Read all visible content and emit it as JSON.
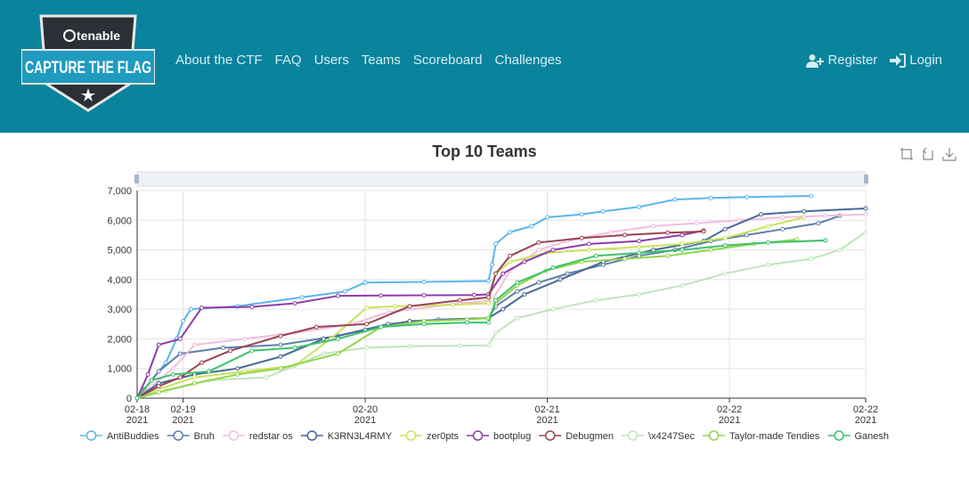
{
  "nav": {
    "logo_brand": "tenable",
    "logo_title": "CAPTURE THE FLAG",
    "links": [
      "About the CTF",
      "FAQ",
      "Users",
      "Teams",
      "Scoreboard",
      "Challenges"
    ],
    "register_label": "Register",
    "login_label": "Login",
    "icons": {
      "register": "user-plus-icon",
      "login": "sign-in-icon"
    }
  },
  "toolbox": [
    "zoom-icon",
    "zoom-reset-icon",
    "download-icon"
  ],
  "chart_data": {
    "type": "line",
    "title": "Top 10 Teams",
    "x_ticks": [
      [
        "02-18",
        "2021"
      ],
      [
        "02-19",
        "2021"
      ],
      [
        "02-20",
        "2021"
      ],
      [
        "02-21",
        "2021"
      ],
      [
        "02-22",
        "2021"
      ],
      [
        "02-22",
        "2021"
      ]
    ],
    "x_tick_days": [
      0,
      0.64,
      3.18,
      5.72,
      8.26,
      10.16
    ],
    "xlim_days": [
      0,
      10.16
    ],
    "ylim": [
      0,
      7000
    ],
    "y_ticks": [
      0,
      1000,
      2000,
      3000,
      4000,
      5000,
      6000,
      7000
    ],
    "y_tick_labels": [
      "0",
      "1,000",
      "2,000",
      "3,000",
      "4,000",
      "5,000",
      "6,000",
      "7,000"
    ],
    "x_unit": "days since 02-18 2021",
    "grid": true,
    "legend_position": "bottom",
    "series": [
      {
        "name": "AntiBuddies",
        "color": "#5ab6ea",
        "x": [
          0,
          0.2,
          0.4,
          0.55,
          0.64,
          0.75,
          1.4,
          2.3,
          2.9,
          3.18,
          4.0,
          4.9,
          4.95,
          5.0,
          5.2,
          5.5,
          5.72,
          6.2,
          6.5,
          7.0,
          7.5,
          8.0,
          8.5,
          9.4
        ],
        "y": [
          0,
          600,
          1200,
          2000,
          2600,
          3000,
          3100,
          3400,
          3600,
          3900,
          3920,
          3950,
          4500,
          5200,
          5600,
          5800,
          6100,
          6200,
          6300,
          6450,
          6700,
          6750,
          6780,
          6820
        ]
      },
      {
        "name": "Bruh",
        "color": "#5e7ea8",
        "x": [
          0,
          0.1,
          0.3,
          0.6,
          1.2,
          2.0,
          2.8,
          3.5,
          4.2,
          4.9,
          5.0,
          5.3,
          5.6,
          6.0,
          6.5,
          7.0,
          7.5,
          8.0,
          8.5,
          9.0,
          9.5,
          9.8
        ],
        "y": [
          0,
          300,
          900,
          1500,
          1700,
          1800,
          2100,
          2500,
          2650,
          2700,
          3100,
          3600,
          3900,
          4200,
          4500,
          4800,
          5000,
          5300,
          5500,
          5700,
          5900,
          6150
        ]
      },
      {
        "name": "redstar os",
        "color": "#f1bede",
        "x": [
          0,
          0.2,
          0.5,
          0.8,
          1.5,
          2.2,
          3.0,
          3.5,
          4.5,
          4.95,
          5.2,
          5.6,
          6.0,
          6.6,
          7.2,
          7.8,
          8.4,
          9.0,
          9.6,
          10.16
        ],
        "y": [
          0,
          400,
          1000,
          1800,
          2000,
          2200,
          2500,
          2900,
          3200,
          3300,
          4300,
          5000,
          5300,
          5600,
          5800,
          5900,
          6000,
          6100,
          6150,
          6200
        ]
      },
      {
        "name": "K3RN3L4RMY",
        "color": "#466996",
        "x": [
          0,
          0.3,
          0.8,
          1.4,
          2.0,
          2.6,
          3.18,
          3.8,
          4.9,
          5.1,
          5.4,
          5.9,
          6.5,
          7.2,
          7.9,
          8.2,
          8.7,
          9.3,
          10.16
        ],
        "y": [
          0,
          500,
          800,
          1000,
          1400,
          2000,
          2300,
          2600,
          2700,
          3000,
          3500,
          4000,
          4600,
          5000,
          5300,
          5700,
          6200,
          6300,
          6400
        ]
      },
      {
        "name": "zer0pts",
        "color": "#c8e35b",
        "x": [
          0,
          0.3,
          0.8,
          1.5,
          2.2,
          2.7,
          3.2,
          3.6,
          4.4,
          4.9,
          5.0,
          5.2,
          5.7,
          6.3,
          7.0,
          7.6,
          8.2,
          8.8,
          9.3
        ],
        "y": [
          0,
          300,
          700,
          900,
          1100,
          2000,
          3050,
          3100,
          3150,
          3200,
          4200,
          4600,
          4900,
          5000,
          5100,
          5200,
          5400,
          5800,
          6100
        ]
      },
      {
        "name": "bootplug",
        "color": "#8e3da8",
        "x": [
          0,
          0.15,
          0.3,
          0.6,
          0.9,
          1.6,
          2.2,
          2.8,
          3.4,
          4.0,
          4.7,
          4.9,
          5.1,
          5.4,
          5.8,
          6.3,
          7.0,
          7.6,
          7.9
        ],
        "y": [
          0,
          800,
          1800,
          2000,
          3050,
          3080,
          3200,
          3450,
          3460,
          3470,
          3480,
          3500,
          4200,
          4600,
          5000,
          5200,
          5300,
          5500,
          5650
        ]
      },
      {
        "name": "Debugmen",
        "color": "#9a4352",
        "x": [
          0,
          0.3,
          0.6,
          0.9,
          1.3,
          2.0,
          2.5,
          3.2,
          3.8,
          4.5,
          4.9,
          5.0,
          5.2,
          5.6,
          6.2,
          6.8,
          7.4,
          7.9
        ],
        "y": [
          0,
          400,
          700,
          1200,
          1600,
          2100,
          2400,
          2500,
          3100,
          3300,
          3400,
          4200,
          4800,
          5250,
          5400,
          5500,
          5580,
          5620
        ]
      },
      {
        "name": "\\x4247Sec",
        "color": "#bde6b8",
        "x": [
          0,
          0.4,
          1.0,
          1.8,
          2.6,
          3.2,
          3.8,
          4.5,
          4.9,
          5.0,
          5.3,
          5.8,
          6.4,
          7.0,
          7.6,
          8.2,
          8.8,
          9.4,
          9.8,
          10.16
        ],
        "y": [
          0,
          250,
          600,
          700,
          1500,
          1700,
          1750,
          1770,
          1780,
          2200,
          2700,
          3000,
          3300,
          3500,
          3800,
          4200,
          4500,
          4700,
          5000,
          5600
        ]
      },
      {
        "name": "Taylor-made Tendies",
        "color": "#93d54c",
        "x": [
          0,
          0.3,
          0.8,
          1.4,
          2.0,
          2.8,
          3.4,
          4.0,
          4.6,
          4.9,
          5.0,
          5.3,
          5.7,
          6.2,
          6.8,
          7.4,
          8.0,
          8.6,
          9.2
        ],
        "y": [
          0,
          200,
          500,
          800,
          1000,
          1500,
          2400,
          2600,
          2650,
          2700,
          3200,
          3800,
          4300,
          4600,
          4700,
          4800,
          5000,
          5200,
          5350
        ]
      },
      {
        "name": "Ganesh",
        "color": "#3cc16c",
        "x": [
          0,
          0.2,
          0.5,
          1.0,
          1.6,
          2.2,
          2.8,
          3.4,
          4.0,
          4.6,
          4.9,
          5.0,
          5.3,
          5.8,
          6.4,
          7.0,
          7.6,
          8.2,
          8.8,
          9.6
        ],
        "y": [
          0,
          600,
          800,
          900,
          1600,
          1700,
          2000,
          2400,
          2500,
          2550,
          2550,
          3300,
          3900,
          4400,
          4800,
          4900,
          5000,
          5150,
          5250,
          5320
        ]
      }
    ]
  }
}
